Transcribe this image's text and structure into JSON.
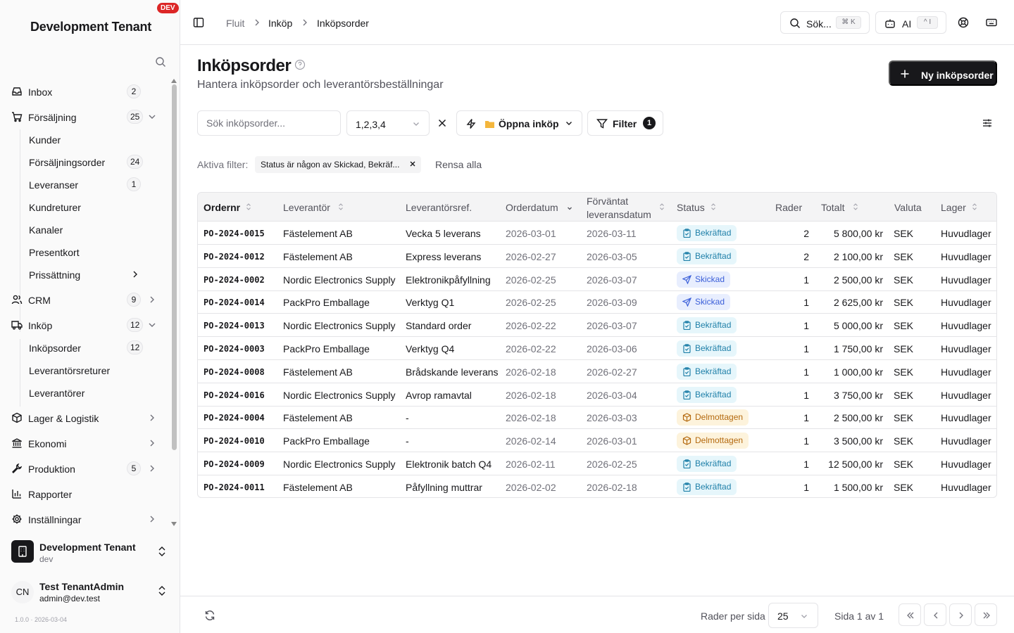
{
  "sidebar": {
    "tenant_title": "Development Tenant",
    "dev_badge": "DEV",
    "items": [
      {
        "label": "Inbox",
        "count": "2"
      },
      {
        "label": "Försäljning",
        "count": "25"
      },
      {
        "label": "Kunder"
      },
      {
        "label": "Försäljningsorder",
        "count": "24"
      },
      {
        "label": "Leveranser",
        "count": "1"
      },
      {
        "label": "Kundreturer"
      },
      {
        "label": "Kanaler"
      },
      {
        "label": "Presentkort"
      },
      {
        "label": "Prissättning"
      },
      {
        "label": "CRM",
        "count": "9"
      },
      {
        "label": "Inköp",
        "count": "12"
      },
      {
        "label": "Inköpsorder",
        "count": "12"
      },
      {
        "label": "Leverantörsreturer"
      },
      {
        "label": "Leverantörer"
      },
      {
        "label": "Lager & Logistik"
      },
      {
        "label": "Ekonomi"
      },
      {
        "label": "Produktion",
        "count": "5"
      },
      {
        "label": "Rapporter"
      },
      {
        "label": "Inställningar"
      }
    ],
    "org": {
      "name": "Development Tenant",
      "sub": "dev"
    },
    "user": {
      "initials": "CN",
      "name": "Test TenantAdmin",
      "email": "admin@dev.test"
    },
    "version": "1.0.0 · 2026-03-04"
  },
  "header": {
    "breadcrumb": [
      "Fluit",
      "Inköp",
      "Inköpsorder"
    ],
    "search_label": "Sök...",
    "search_kbd": "⌘ K",
    "ai_label": "AI",
    "ai_kbd": "^ I"
  },
  "page": {
    "title": "Inköpsorder",
    "subtitle": "Hantera inköpsorder och leverantörsbeställningar",
    "new_button": "Ny inköpsorder"
  },
  "toolbar": {
    "search_placeholder": "Sök inköpsorder...",
    "select_value": "1,2,3,4",
    "view_label": "Öppna inköp",
    "filter_label": "Filter",
    "filter_count": "1"
  },
  "active_filters": {
    "label": "Aktiva filter:",
    "chip": "Status är någon av Skickad, Bekräf...",
    "clear_all": "Rensa alla"
  },
  "table": {
    "headers": {
      "ordernr": "Ordernr",
      "supplier": "Leverantör",
      "ref": "Leverantörsref.",
      "date": "Orderdatum",
      "expected_1": "Förväntat",
      "expected_2": "leveransdatum",
      "status": "Status",
      "rows": "Rader",
      "total": "Totalt",
      "currency": "Valuta",
      "warehouse": "Lager"
    },
    "rows": [
      {
        "nr": "PO-2024-0015",
        "supplier": "Fästelement AB",
        "ref": "Vecka 5 leverans",
        "date": "2026-03-01",
        "expected": "2026-03-11",
        "status": "Bekräftad",
        "st": "b",
        "lines": "2",
        "total": "5 800,00 kr",
        "cur": "SEK",
        "wh": "Huvudlager"
      },
      {
        "nr": "PO-2024-0012",
        "supplier": "Fästelement AB",
        "ref": "Express leverans",
        "date": "2026-02-27",
        "expected": "2026-03-05",
        "status": "Bekräftad",
        "st": "b",
        "lines": "2",
        "total": "2 100,00 kr",
        "cur": "SEK",
        "wh": "Huvudlager"
      },
      {
        "nr": "PO-2024-0002",
        "supplier": "Nordic Electronics Supply",
        "ref": "Elektronikpåfyllning",
        "date": "2026-02-25",
        "expected": "2026-03-07",
        "status": "Skickad",
        "st": "s",
        "lines": "1",
        "total": "2 500,00 kr",
        "cur": "SEK",
        "wh": "Huvudlager"
      },
      {
        "nr": "PO-2024-0014",
        "supplier": "PackPro Emballage",
        "ref": "Verktyg Q1",
        "date": "2026-02-25",
        "expected": "2026-03-09",
        "status": "Skickad",
        "st": "s",
        "lines": "1",
        "total": "2 625,00 kr",
        "cur": "SEK",
        "wh": "Huvudlager"
      },
      {
        "nr": "PO-2024-0013",
        "supplier": "Nordic Electronics Supply",
        "ref": "Standard order",
        "date": "2026-02-22",
        "expected": "2026-03-07",
        "status": "Bekräftad",
        "st": "b",
        "lines": "1",
        "total": "5 000,00 kr",
        "cur": "SEK",
        "wh": "Huvudlager"
      },
      {
        "nr": "PO-2024-0003",
        "supplier": "PackPro Emballage",
        "ref": "Verktyg Q4",
        "date": "2026-02-22",
        "expected": "2026-03-06",
        "status": "Bekräftad",
        "st": "b",
        "lines": "1",
        "total": "1 750,00 kr",
        "cur": "SEK",
        "wh": "Huvudlager"
      },
      {
        "nr": "PO-2024-0008",
        "supplier": "Fästelement AB",
        "ref": "Brådskande leverans",
        "date": "2026-02-18",
        "expected": "2026-02-27",
        "status": "Bekräftad",
        "st": "b",
        "lines": "1",
        "total": "1 000,00 kr",
        "cur": "SEK",
        "wh": "Huvudlager"
      },
      {
        "nr": "PO-2024-0016",
        "supplier": "Nordic Electronics Supply",
        "ref": "Avrop ramavtal",
        "date": "2026-02-18",
        "expected": "2026-03-04",
        "status": "Bekräftad",
        "st": "b",
        "lines": "1",
        "total": "3 750,00 kr",
        "cur": "SEK",
        "wh": "Huvudlager"
      },
      {
        "nr": "PO-2024-0004",
        "supplier": "Fästelement AB",
        "ref": "-",
        "date": "2026-02-18",
        "expected": "2026-03-03",
        "status": "Delmottagen",
        "st": "d",
        "lines": "1",
        "total": "2 500,00 kr",
        "cur": "SEK",
        "wh": "Huvudlager"
      },
      {
        "nr": "PO-2024-0010",
        "supplier": "PackPro Emballage",
        "ref": "-",
        "date": "2026-02-14",
        "expected": "2026-03-01",
        "status": "Delmottagen",
        "st": "d",
        "lines": "1",
        "total": "3 500,00 kr",
        "cur": "SEK",
        "wh": "Huvudlager"
      },
      {
        "nr": "PO-2024-0009",
        "supplier": "Nordic Electronics Supply",
        "ref": "Elektronik batch Q4",
        "date": "2026-02-11",
        "expected": "2026-02-25",
        "status": "Bekräftad",
        "st": "b",
        "lines": "1",
        "total": "12 500,00 kr",
        "cur": "SEK",
        "wh": "Huvudlager"
      },
      {
        "nr": "PO-2024-0011",
        "supplier": "Fästelement AB",
        "ref": "Påfyllning muttrar",
        "date": "2026-02-02",
        "expected": "2026-02-18",
        "status": "Bekräftad",
        "st": "b",
        "lines": "1",
        "total": "1 500,00 kr",
        "cur": "SEK",
        "wh": "Huvudlager"
      }
    ]
  },
  "footer": {
    "rows_per_page_label": "Rader per sida",
    "rows_per_page": "25",
    "page_info": "Sida 1 av 1"
  },
  "colors": {
    "primary": "#18181b",
    "dev_badge": "#dc2626",
    "status_bekraftad": "#1e7fa8",
    "status_skickad": "#3b5fd9",
    "status_delmottagen": "#b4690e"
  }
}
